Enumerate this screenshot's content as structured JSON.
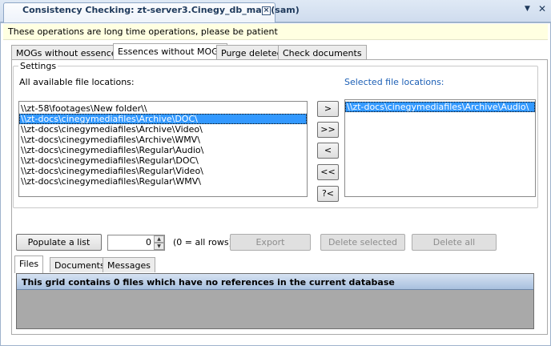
{
  "window": {
    "title": "Consistency Checking: zt-server3.Cinegy_db_main(sam)",
    "close_glyph": "×",
    "menu_glyph": "▼",
    "window_close_glyph": "✕"
  },
  "info": {
    "text": "These operations are long time operations, please be patient"
  },
  "tabs": [
    {
      "label": "MOGs without essences",
      "active": false
    },
    {
      "label": "Essences without MOGs",
      "active": true
    },
    {
      "label": "Purge deleted",
      "active": false
    },
    {
      "label": "Check documents",
      "active": false
    }
  ],
  "settings": {
    "legend": "Settings",
    "available_label": "All available file locations:",
    "selected_label": "Selected file locations:",
    "available_items": [
      {
        "text": "\\\\zt-58\\footages\\New folder\\\\",
        "selected": false
      },
      {
        "text": "\\\\zt-docs\\cinegymediafiles\\Archive\\DOC\\",
        "selected": true
      },
      {
        "text": "\\\\zt-docs\\cinegymediafiles\\Archive\\Video\\",
        "selected": false
      },
      {
        "text": "\\\\zt-docs\\cinegymediafiles\\Archive\\WMV\\",
        "selected": false
      },
      {
        "text": "\\\\zt-docs\\cinegymediafiles\\Regular\\Audio\\",
        "selected": false
      },
      {
        "text": "\\\\zt-docs\\cinegymediafiles\\Regular\\DOC\\",
        "selected": false
      },
      {
        "text": "\\\\zt-docs\\cinegymediafiles\\Regular\\Video\\",
        "selected": false
      },
      {
        "text": "\\\\zt-docs\\cinegymediafiles\\Regular\\WMV\\",
        "selected": false
      }
    ],
    "selected_items": [
      {
        "text": "\\\\zt-docs\\cinegymediafiles\\Archive\\Audio\\",
        "selected": true
      }
    ],
    "move_buttons": [
      ">",
      ">>",
      "<",
      "<<",
      "?<"
    ]
  },
  "actions": {
    "populate_label": "Populate a list",
    "count_value": "0",
    "count_hint": "(0 = all rows)",
    "export_label": "Export",
    "delete_selected_label": "Delete selected",
    "delete_all_label": "Delete all"
  },
  "bottom_tabs": [
    {
      "label": "Files",
      "active": true
    },
    {
      "label": "Documents",
      "active": false
    },
    {
      "label": "Messages",
      "active": false
    }
  ],
  "grid": {
    "message": "This grid contains 0 files which have no references in the current database"
  },
  "colors": {
    "selection": "#3399ff",
    "info_background": "#ffffe1",
    "selected_label": "#1c5fb5"
  }
}
